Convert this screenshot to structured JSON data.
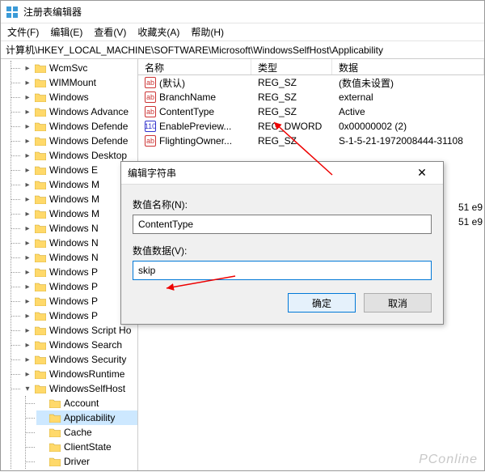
{
  "title": "注册表编辑器",
  "menus": {
    "file": "文件(F)",
    "edit": "编辑(E)",
    "view": "查看(V)",
    "fav": "收藏夹(A)",
    "help": "帮助(H)"
  },
  "address": "计算机\\HKEY_LOCAL_MACHINE\\SOFTWARE\\Microsoft\\WindowsSelfHost\\Applicability",
  "tree": {
    "items": [
      {
        "label": "WcmSvc"
      },
      {
        "label": "WIMMount"
      },
      {
        "label": "Windows"
      },
      {
        "label": "Windows Advance"
      },
      {
        "label": "Windows Defende"
      },
      {
        "label": "Windows Defende"
      },
      {
        "label": "Windows Desktop"
      },
      {
        "label": "Windows E"
      },
      {
        "label": "Windows M"
      },
      {
        "label": "Windows M"
      },
      {
        "label": "Windows M"
      },
      {
        "label": "Windows N"
      },
      {
        "label": "Windows N"
      },
      {
        "label": "Windows N"
      },
      {
        "label": "Windows P"
      },
      {
        "label": "Windows P"
      },
      {
        "label": "Windows P"
      },
      {
        "label": "Windows P"
      },
      {
        "label": "Windows Script Ho"
      },
      {
        "label": "Windows Search"
      },
      {
        "label": "Windows Security"
      },
      {
        "label": "WindowsRuntime"
      },
      {
        "label": "WindowsSelfHost",
        "expanded": true,
        "children": [
          {
            "label": "Account"
          },
          {
            "label": "Applicability",
            "selected": true
          },
          {
            "label": "Cache"
          },
          {
            "label": "ClientState"
          },
          {
            "label": "Driver"
          }
        ]
      }
    ]
  },
  "columns": {
    "name": "名称",
    "type": "类型",
    "data": "数据"
  },
  "values": [
    {
      "icon": "sz",
      "name": "(默认)",
      "type": "REG_SZ",
      "data": "(数值未设置)"
    },
    {
      "icon": "sz",
      "name": "BranchName",
      "type": "REG_SZ",
      "data": "external"
    },
    {
      "icon": "sz",
      "name": "ContentType",
      "type": "REG_SZ",
      "data": "Active"
    },
    {
      "icon": "dw",
      "name": "EnablePreview...",
      "type": "REG_DWORD",
      "data": "0x00000002 (2)"
    },
    {
      "icon": "sz",
      "name": "FlightingOwner...",
      "type": "REG_SZ",
      "data": "S-1-5-21-1972008444-31108"
    }
  ],
  "trailing": {
    "a": "51 e9",
    "b": "51 e9"
  },
  "dialog": {
    "title": "编辑字符串",
    "name_label": "数值名称(N):",
    "name_value": "ContentType",
    "data_label": "数值数据(V):",
    "data_value": "skip",
    "ok": "确定",
    "cancel": "取消"
  },
  "watermark": "PConline"
}
